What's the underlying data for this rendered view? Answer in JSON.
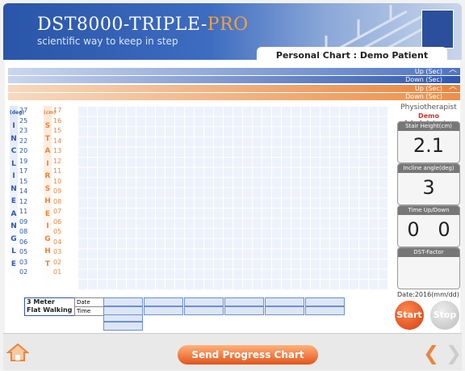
{
  "header": {
    "brand_main": "DST8000-TRIPLE-",
    "brand_pro": "PRO",
    "tagline": "scientific way to keep in step",
    "chart_title": "Personal Chart : Demo Patient"
  },
  "bars": {
    "blue_up": "Up (Sec)",
    "blue_down": "Down (Sec)",
    "orange_up": "Up (Sec)",
    "orange_down": "Down (Sec)"
  },
  "incline_axis": {
    "letters": [
      "(deg)",
      "I",
      "N",
      "C",
      "L",
      "I",
      "N",
      "E",
      " ",
      "A",
      "N",
      "G",
      "L",
      "E"
    ],
    "values": [
      "27",
      "25",
      "23",
      "22",
      "20",
      "19",
      "17",
      "15",
      "14",
      "12",
      "11",
      "09",
      "08",
      "06",
      "05",
      "03",
      "02"
    ]
  },
  "stairs_axis": {
    "letters": [
      "(cm)",
      "S",
      "T",
      "A",
      "I",
      "R",
      "S",
      " ",
      "H",
      "E",
      "I",
      "G",
      "H",
      "T"
    ],
    "values": [
      "17",
      "16",
      "15",
      "14",
      "13",
      "12",
      "11",
      "10",
      "09",
      "08",
      "07",
      "06",
      "05",
      "04",
      "03",
      "02",
      "01"
    ]
  },
  "walk": {
    "label_line1": "3 Meter",
    "label_line2": "Flat Walking",
    "date": "Date",
    "time": "Time"
  },
  "panel": {
    "physio_title": "Physiotherapist",
    "admin_name": "Demo Administrator",
    "stair_height_title": "Stair Height(cm)",
    "stair_height_value": "2.1",
    "incline_title": "Incline angle(deg)",
    "incline_value": "3",
    "time_title": "Time Up/Down",
    "time_up": "0",
    "time_down": "0",
    "dst_title": "DST-Factor",
    "dst_value": "",
    "date_label": "Date:2016(mm/dd)"
  },
  "buttons": {
    "start": "Start",
    "stop": "Stop",
    "send": "Send Progress Chart"
  },
  "colors": {
    "blue": "#2e57ad",
    "orange": "#e8853f"
  }
}
